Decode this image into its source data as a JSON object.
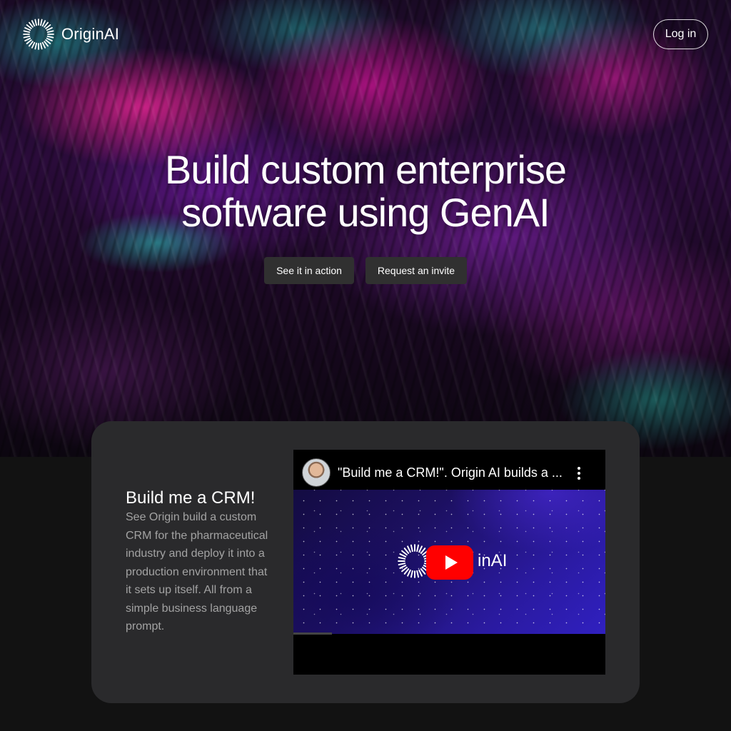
{
  "brand": {
    "name": "OriginAI",
    "logo_icon": "radial-burst-icon"
  },
  "nav": {
    "login_label": "Log in"
  },
  "hero": {
    "headline_line1": "Build custom enterprise",
    "headline_line2": "software using GenAI",
    "cta_primary": "See it in action",
    "cta_secondary": "Request an invite"
  },
  "feature_card": {
    "title": "Build me a CRM!",
    "description": "See Origin build a custom CRM for the pharmaceutical industry and deploy it into a production environment that it sets up itself. All from a simple business language prompt."
  },
  "video": {
    "title": "\"Build me a CRM!\". Origin AI builds a ...",
    "logo_text": "inAI",
    "play_icon": "youtube-play-icon",
    "menu_icon": "kebab-menu-icon",
    "player_color": "#ff0000"
  },
  "colors": {
    "page_bg": "#121212",
    "card_bg": "#2a2a2c",
    "button_bg": "#303030",
    "muted_text": "#a3a3a3"
  }
}
